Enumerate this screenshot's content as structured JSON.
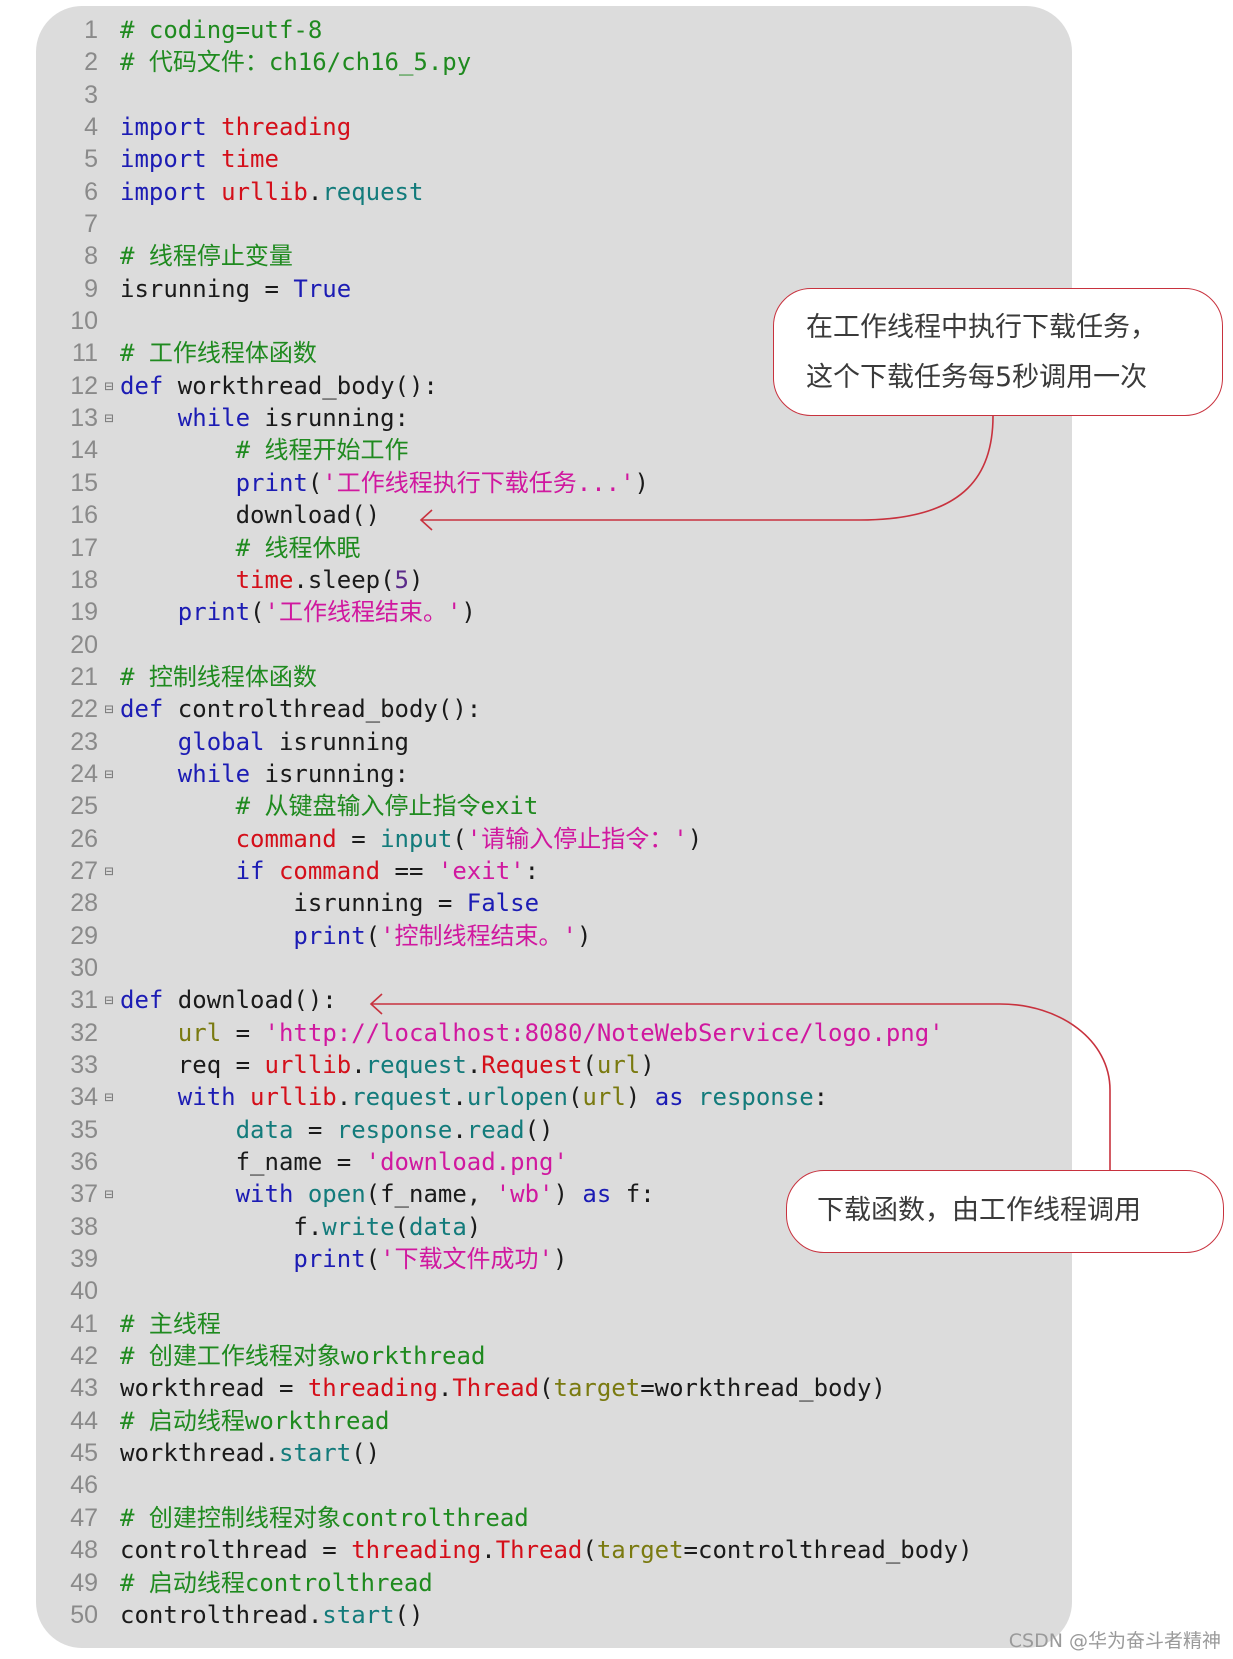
{
  "document": {
    "language": "python",
    "lines": [
      {
        "n": "1",
        "fold": false,
        "indent": 0,
        "tokens": [
          [
            "cm",
            "# coding=utf-8"
          ]
        ]
      },
      {
        "n": "2",
        "fold": false,
        "indent": 0,
        "tokens": [
          [
            "cm",
            "# 代码文件：ch16/ch16_5.py"
          ]
        ]
      },
      {
        "n": "3",
        "fold": false,
        "indent": 0,
        "tokens": []
      },
      {
        "n": "4",
        "fold": false,
        "indent": 0,
        "tokens": [
          [
            "kw",
            "import "
          ],
          [
            "mod",
            "threading"
          ]
        ]
      },
      {
        "n": "5",
        "fold": false,
        "indent": 0,
        "tokens": [
          [
            "kw",
            "import "
          ],
          [
            "mod",
            "time"
          ]
        ]
      },
      {
        "n": "6",
        "fold": false,
        "indent": 0,
        "tokens": [
          [
            "kw",
            "import "
          ],
          [
            "mod",
            "urllib"
          ],
          [
            "plain",
            "."
          ],
          [
            "fn",
            "request"
          ]
        ]
      },
      {
        "n": "7",
        "fold": false,
        "indent": 0,
        "tokens": []
      },
      {
        "n": "8",
        "fold": false,
        "indent": 0,
        "tokens": [
          [
            "cm",
            "# 线程停止变量"
          ]
        ]
      },
      {
        "n": "9",
        "fold": false,
        "indent": 0,
        "tokens": [
          [
            "plain",
            "isrunning = "
          ],
          [
            "kw",
            "True"
          ]
        ]
      },
      {
        "n": "10",
        "fold": false,
        "indent": 0,
        "tokens": []
      },
      {
        "n": "11",
        "fold": false,
        "indent": 0,
        "tokens": [
          [
            "cm",
            "# 工作线程体函数"
          ]
        ]
      },
      {
        "n": "12",
        "fold": true,
        "indent": 0,
        "tokens": [
          [
            "kw",
            "def "
          ],
          [
            "plain",
            "workthread_body():"
          ]
        ]
      },
      {
        "n": "13",
        "fold": true,
        "indent": 1,
        "tokens": [
          [
            "kw",
            "while "
          ],
          [
            "plain",
            "isrunning:"
          ]
        ]
      },
      {
        "n": "14",
        "fold": false,
        "indent": 2,
        "tokens": [
          [
            "cm",
            "# 线程开始工作"
          ]
        ]
      },
      {
        "n": "15",
        "fold": false,
        "indent": 2,
        "tokens": [
          [
            "kw",
            "print"
          ],
          [
            "plain",
            "("
          ],
          [
            "str",
            "'工作线程执行下载任务...'"
          ],
          [
            "plain",
            ")"
          ]
        ]
      },
      {
        "n": "16",
        "fold": false,
        "indent": 2,
        "tokens": [
          [
            "plain",
            "download()"
          ]
        ]
      },
      {
        "n": "17",
        "fold": false,
        "indent": 2,
        "tokens": [
          [
            "cm",
            "# 线程休眠"
          ]
        ]
      },
      {
        "n": "18",
        "fold": false,
        "indent": 2,
        "tokens": [
          [
            "mod",
            "time"
          ],
          [
            "plain",
            ".sleep("
          ],
          [
            "num",
            "5"
          ],
          [
            "plain",
            ")"
          ]
        ]
      },
      {
        "n": "19",
        "fold": false,
        "indent": 1,
        "tokens": [
          [
            "kw",
            "print"
          ],
          [
            "plain",
            "("
          ],
          [
            "str",
            "'工作线程结束。'"
          ],
          [
            "plain",
            ")"
          ]
        ]
      },
      {
        "n": "20",
        "fold": false,
        "indent": 0,
        "tokens": []
      },
      {
        "n": "21",
        "fold": false,
        "indent": 0,
        "tokens": [
          [
            "cm",
            "# 控制线程体函数"
          ]
        ]
      },
      {
        "n": "22",
        "fold": true,
        "indent": 0,
        "tokens": [
          [
            "kw",
            "def "
          ],
          [
            "plain",
            "controlthread_body():"
          ]
        ]
      },
      {
        "n": "23",
        "fold": false,
        "indent": 1,
        "tokens": [
          [
            "kw",
            "global "
          ],
          [
            "plain",
            "isrunning"
          ]
        ]
      },
      {
        "n": "24",
        "fold": true,
        "indent": 1,
        "tokens": [
          [
            "kw",
            "while "
          ],
          [
            "plain",
            "isrunning:"
          ]
        ]
      },
      {
        "n": "25",
        "fold": false,
        "indent": 2,
        "tokens": [
          [
            "cm",
            "# 从键盘输入停止指令exit"
          ]
        ]
      },
      {
        "n": "26",
        "fold": false,
        "indent": 2,
        "tokens": [
          [
            "mod",
            "command"
          ],
          [
            "plain",
            " = "
          ],
          [
            "fn",
            "input"
          ],
          [
            "plain",
            "("
          ],
          [
            "str",
            "'请输入停止指令：'"
          ],
          [
            "plain",
            ")"
          ]
        ]
      },
      {
        "n": "27",
        "fold": true,
        "indent": 2,
        "tokens": [
          [
            "kw",
            "if "
          ],
          [
            "mod",
            "command"
          ],
          [
            "plain",
            " == "
          ],
          [
            "str",
            "'exit'"
          ],
          [
            "plain",
            ":"
          ]
        ]
      },
      {
        "n": "28",
        "fold": false,
        "indent": 3,
        "tokens": [
          [
            "plain",
            "isrunning = "
          ],
          [
            "kw",
            "False"
          ]
        ]
      },
      {
        "n": "29",
        "fold": false,
        "indent": 3,
        "tokens": [
          [
            "kw",
            "print"
          ],
          [
            "plain",
            "("
          ],
          [
            "str",
            "'控制线程结束。'"
          ],
          [
            "plain",
            ")"
          ]
        ]
      },
      {
        "n": "30",
        "fold": false,
        "indent": 0,
        "tokens": []
      },
      {
        "n": "31",
        "fold": true,
        "indent": 0,
        "tokens": [
          [
            "kw",
            "def "
          ],
          [
            "plain",
            "download():"
          ]
        ]
      },
      {
        "n": "32",
        "fold": false,
        "indent": 1,
        "tokens": [
          [
            "var",
            "url"
          ],
          [
            "plain",
            " = "
          ],
          [
            "str",
            "'http://localhost:8080/NoteWebService/logo.png'"
          ]
        ]
      },
      {
        "n": "33",
        "fold": false,
        "indent": 1,
        "tokens": [
          [
            "plain",
            "req = "
          ],
          [
            "mod",
            "urllib"
          ],
          [
            "plain",
            "."
          ],
          [
            "fn",
            "request"
          ],
          [
            "plain",
            "."
          ],
          [
            "mod",
            "Request"
          ],
          [
            "plain",
            "("
          ],
          [
            "var",
            "url"
          ],
          [
            "plain",
            ")"
          ]
        ]
      },
      {
        "n": "34",
        "fold": true,
        "indent": 1,
        "tokens": [
          [
            "kw",
            "with "
          ],
          [
            "mod",
            "urllib"
          ],
          [
            "plain",
            "."
          ],
          [
            "fn",
            "request"
          ],
          [
            "plain",
            "."
          ],
          [
            "fn",
            "urlopen"
          ],
          [
            "plain",
            "("
          ],
          [
            "var",
            "url"
          ],
          [
            "plain",
            ") "
          ],
          [
            "kw",
            "as "
          ],
          [
            "fn",
            "response"
          ],
          [
            "plain",
            ":"
          ]
        ]
      },
      {
        "n": "35",
        "fold": false,
        "indent": 2,
        "tokens": [
          [
            "fn",
            "data"
          ],
          [
            "plain",
            " = "
          ],
          [
            "fn",
            "response"
          ],
          [
            "plain",
            "."
          ],
          [
            "fn",
            "read"
          ],
          [
            "plain",
            "()"
          ]
        ]
      },
      {
        "n": "36",
        "fold": false,
        "indent": 2,
        "tokens": [
          [
            "plain",
            "f_name = "
          ],
          [
            "str",
            "'download.png'"
          ]
        ]
      },
      {
        "n": "37",
        "fold": true,
        "indent": 2,
        "tokens": [
          [
            "kw",
            "with "
          ],
          [
            "fn",
            "open"
          ],
          [
            "plain",
            "(f_name, "
          ],
          [
            "str",
            "'wb'"
          ],
          [
            "plain",
            ") "
          ],
          [
            "kw",
            "as "
          ],
          [
            "plain",
            "f:"
          ]
        ]
      },
      {
        "n": "38",
        "fold": false,
        "indent": 3,
        "tokens": [
          [
            "plain",
            "f."
          ],
          [
            "fn",
            "write"
          ],
          [
            "plain",
            "("
          ],
          [
            "fn",
            "data"
          ],
          [
            "plain",
            ")"
          ]
        ]
      },
      {
        "n": "39",
        "fold": false,
        "indent": 3,
        "tokens": [
          [
            "kw",
            "print"
          ],
          [
            "plain",
            "("
          ],
          [
            "str",
            "'下载文件成功'"
          ],
          [
            "plain",
            ")"
          ]
        ]
      },
      {
        "n": "40",
        "fold": false,
        "indent": 0,
        "tokens": []
      },
      {
        "n": "41",
        "fold": false,
        "indent": 0,
        "tokens": [
          [
            "cm",
            "# 主线程"
          ]
        ]
      },
      {
        "n": "42",
        "fold": false,
        "indent": 0,
        "tokens": [
          [
            "cm",
            "# 创建工作线程对象workthread"
          ]
        ]
      },
      {
        "n": "43",
        "fold": false,
        "indent": 0,
        "tokens": [
          [
            "plain",
            "workthread = "
          ],
          [
            "mod",
            "threading"
          ],
          [
            "plain",
            "."
          ],
          [
            "mod",
            "Thread"
          ],
          [
            "plain",
            "("
          ],
          [
            "var",
            "target"
          ],
          [
            "plain",
            "=workthread_body)"
          ]
        ]
      },
      {
        "n": "44",
        "fold": false,
        "indent": 0,
        "tokens": [
          [
            "cm",
            "# 启动线程workthread"
          ]
        ]
      },
      {
        "n": "45",
        "fold": false,
        "indent": 0,
        "tokens": [
          [
            "plain",
            "workthread."
          ],
          [
            "fn",
            "start"
          ],
          [
            "plain",
            "()"
          ]
        ]
      },
      {
        "n": "46",
        "fold": false,
        "indent": 0,
        "tokens": []
      },
      {
        "n": "47",
        "fold": false,
        "indent": 0,
        "tokens": [
          [
            "cm",
            "# 创建控制线程对象controlthread"
          ]
        ]
      },
      {
        "n": "48",
        "fold": false,
        "indent": 0,
        "tokens": [
          [
            "plain",
            "controlthread = "
          ],
          [
            "mod",
            "threading"
          ],
          [
            "plain",
            "."
          ],
          [
            "mod",
            "Thread"
          ],
          [
            "plain",
            "("
          ],
          [
            "var",
            "target"
          ],
          [
            "plain",
            "=controlthread_body)"
          ]
        ]
      },
      {
        "n": "49",
        "fold": false,
        "indent": 0,
        "tokens": [
          [
            "cm",
            "# 启动线程controlthread"
          ]
        ]
      },
      {
        "n": "50",
        "fold": false,
        "indent": 0,
        "tokens": [
          [
            "plain",
            "controlthread."
          ],
          [
            "fn",
            "start"
          ],
          [
            "plain",
            "()"
          ]
        ]
      }
    ]
  },
  "callouts": {
    "worker": {
      "line1": "在工作线程中执行下载任务，",
      "line2": "这个下载任务每5秒调用一次",
      "points_to_line": "16"
    },
    "download": {
      "text": "下载函数，由工作线程调用",
      "points_to_line": "31"
    }
  },
  "colors": {
    "panel_bg": "#dcdcdc",
    "callout_border": "#c8323e",
    "keyword": "#1c1cb4",
    "module": "#d40f1a",
    "comment": "#1f8a1f",
    "string": "#d0189f",
    "function": "#137b7b"
  },
  "watermark": "CSDN @华为奋斗者精神"
}
